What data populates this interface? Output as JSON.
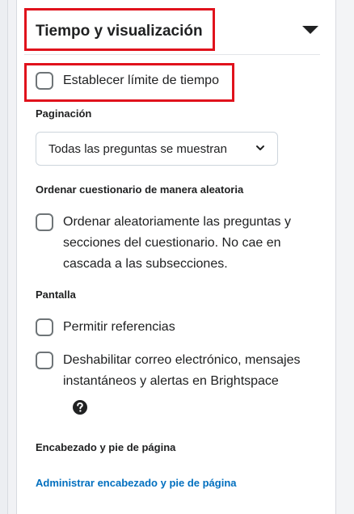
{
  "section": {
    "title": "Tiempo y visualización"
  },
  "time_limit": {
    "label": "Establecer límite de tiempo"
  },
  "pagination": {
    "label": "Paginación",
    "selected": "Todas las preguntas se muestran"
  },
  "shuffle": {
    "label": "Ordenar cuestionario de manera aleatoria",
    "option_label_lines": [
      "Ordenar aleatoriamente las preguntas y",
      "secciones del cuestionario. No cae en",
      "cascada a las subsecciones."
    ]
  },
  "display": {
    "label": "Pantalla",
    "allow_hints_label": "Permitir referencias",
    "disable_comms_lines": [
      "Deshabilitar correo electrónico, mensajes",
      "instantáneos y alertas en Brightspace"
    ]
  },
  "header_footer": {
    "label": "Encabezado y pie de página",
    "link": "Administrar encabezado y pie de página"
  },
  "colors": {
    "highlight": "#e0121c",
    "link": "#006fbf",
    "text": "#202122"
  },
  "icons": {
    "collapse": "triangle-down-icon",
    "select": "chevron-down-icon",
    "help": "help-circle-icon"
  }
}
